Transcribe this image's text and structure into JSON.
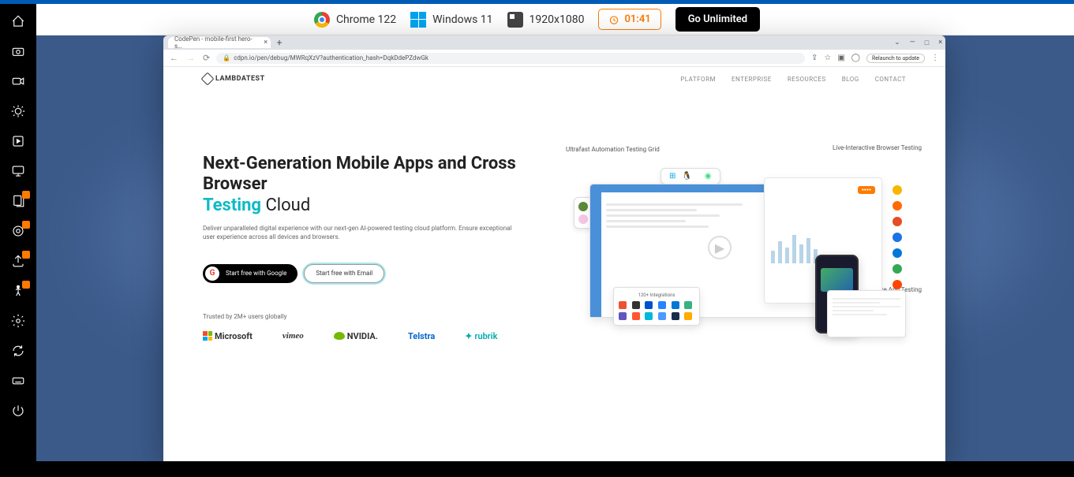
{
  "toolbar": {
    "browser": "Chrome 122",
    "os": "Windows 11",
    "resolution": "1920x1080",
    "timer": "01:41",
    "go_unlimited": "Go Unlimited"
  },
  "browser_window": {
    "tab_title": "CodePen - mobile-first hero-s…",
    "url": "cdpn.io/pen/debug/MWRqXzV?authentication_hash=DqkDdePZdwGk",
    "relaunch": "Relaunch to update"
  },
  "page": {
    "logo": "LAMBDATEST",
    "nav": [
      "PLATFORM",
      "ENTERPRISE",
      "RESOURCES",
      "BLOG",
      "CONTACT"
    ],
    "hero": {
      "title_line1": "Next-Generation Mobile Apps and Cross Browser",
      "title_accent": "Testing",
      "title_light": "Cloud",
      "desc": "Deliver unparalleled digital experience with our next-gen AI-powered testing cloud platform. Ensure exceptional user experience across all devices and browsers.",
      "btn_google": "Start free with Google",
      "btn_email": "Start free with Email",
      "trusted": "Trusted by 2M+ users globally"
    },
    "brands": {
      "microsoft": "Microsoft",
      "vimeo": "vimeo",
      "nvidia": "NVIDIA.",
      "telstra": "Telstra",
      "rubrik": "rubrik"
    },
    "callouts": {
      "automation": "Ultrafast Automation Testing Grid",
      "live": "Live-Interactive Browser Testing",
      "device": "Real Device App Testing"
    },
    "integrations_title": "120+ Integrations"
  }
}
